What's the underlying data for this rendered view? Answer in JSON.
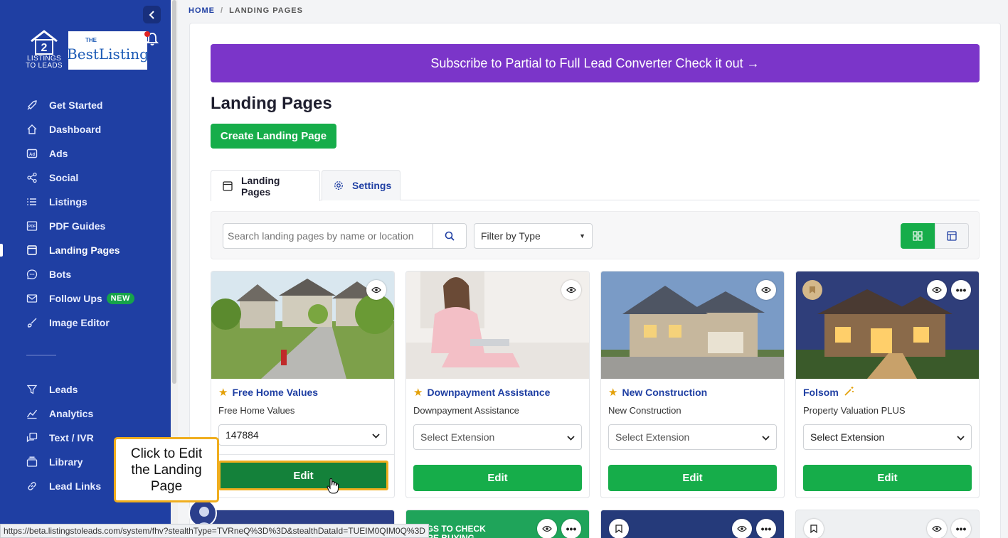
{
  "sidebar": {
    "brand_text_line1": "LISTINGS",
    "brand_text_line2": "TO LEADS",
    "brand_logo_number": "2",
    "partner_logo_the": "THE",
    "partner_logo_text": "BestListing",
    "items": [
      {
        "label": "Get Started",
        "icon": "rocket-icon"
      },
      {
        "label": "Dashboard",
        "icon": "home-icon"
      },
      {
        "label": "Ads",
        "icon": "ad-icon"
      },
      {
        "label": "Social",
        "icon": "share-icon"
      },
      {
        "label": "Listings",
        "icon": "list-icon"
      },
      {
        "label": "PDF Guides",
        "icon": "pdf-icon"
      },
      {
        "label": "Landing Pages",
        "icon": "browser-icon",
        "active": true
      },
      {
        "label": "Bots",
        "icon": "chat-icon"
      },
      {
        "label": "Follow Ups",
        "icon": "mail-icon",
        "badge": "NEW"
      },
      {
        "label": "Image Editor",
        "icon": "brush-icon"
      }
    ],
    "items2": [
      {
        "label": "Leads",
        "icon": "filter-icon"
      },
      {
        "label": "Analytics",
        "icon": "chart-icon"
      },
      {
        "label": "Text / IVR",
        "icon": "message-icon"
      },
      {
        "label": "Library",
        "icon": "folder-icon"
      },
      {
        "label": "Lead Links",
        "icon": "link-icon"
      }
    ]
  },
  "breadcrumb": {
    "home": "HOME",
    "current": "LANDING PAGES",
    "separator": "/"
  },
  "promo": {
    "text": "Subscribe to Partial to Full Lead Converter Check it out →"
  },
  "page": {
    "title": "Landing Pages",
    "create_button": "Create Landing Page"
  },
  "tabs": [
    {
      "label": "Landing Pages",
      "icon": "browser-icon"
    },
    {
      "label": "Settings",
      "icon": "gear-icon"
    }
  ],
  "toolbar": {
    "search_placeholder": "Search landing pages by name or location",
    "filter_label": "Filter by Type"
  },
  "cards": [
    {
      "title": "Free Home Values",
      "subtitle": "Free Home Values",
      "extension": "147884",
      "edit_label": "Edit",
      "starred": true
    },
    {
      "title": "Downpayment Assistance",
      "subtitle": "Downpayment Assistance",
      "extension": "Select Extension",
      "edit_label": "Edit",
      "starred": true
    },
    {
      "title": "New Construction",
      "subtitle": "New Construction",
      "extension": "Select Extension",
      "edit_label": "Edit",
      "starred": true
    },
    {
      "title": "Folsom",
      "subtitle": "Property Valuation PLUS",
      "extension": "Select Extension",
      "edit_label": "Edit",
      "starred": false
    }
  ],
  "second_row_promo": "NGS TO CHECK\nORE BUYING",
  "tooltip": "Click to Edit the Landing Page",
  "status_url": "https://beta.listingstoleads.com/system/fhv?stealthType=TVRneQ%3D%3D&stealthDataId=TUEIM0QIM0Q%3D",
  "colors": {
    "sidebar": "#1f3fa3",
    "accent_green": "#16ad4a",
    "promo_purple": "#7b35c9",
    "highlight": "#f0ae1e"
  }
}
